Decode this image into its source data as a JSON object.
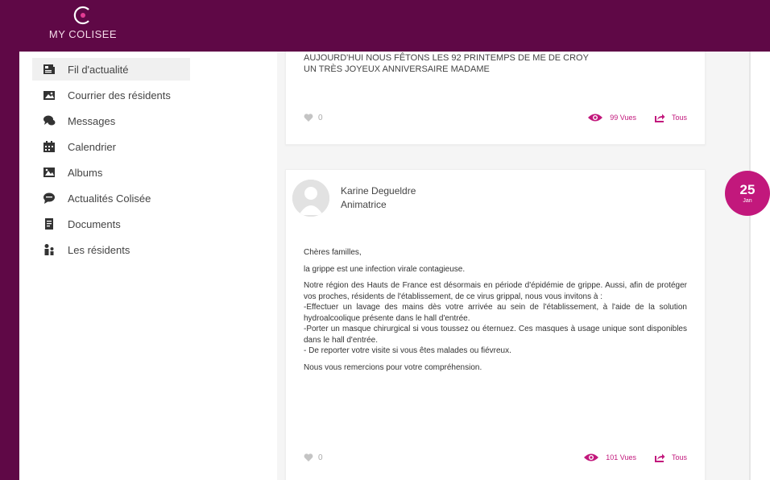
{
  "brand": {
    "name": "MY COLISEE"
  },
  "sidebar": {
    "items": [
      {
        "label": "Fil d'actualité",
        "icon": "newspaper-icon",
        "active": true
      },
      {
        "label": "Courrier des résidents",
        "icon": "mail-image-icon"
      },
      {
        "label": "Messages",
        "icon": "chat-bubbles-icon"
      },
      {
        "label": "Calendrier",
        "icon": "calendar-icon"
      },
      {
        "label": "Albums",
        "icon": "picture-icon"
      },
      {
        "label": "Actualités Colisée",
        "icon": "speech-bubble-icon"
      },
      {
        "label": "Documents",
        "icon": "document-icon"
      },
      {
        "label": "Les résidents",
        "icon": "people-icon"
      }
    ]
  },
  "posts": [
    {
      "lines": [
        "AUJOURD'HUI NOUS FÊTONS LES 92 PRINTEMPS DE ME DE CROY",
        "UN TRÈS JOYEUX ANNIVERSAIRE MADAME"
      ],
      "likes": "0",
      "views": "99 Vues",
      "share": "Tous"
    },
    {
      "author_name": "Karine Degueldre",
      "author_role": "Animatrice",
      "paragraphs": [
        "Chères familles,",
        "la grippe est une infection virale contagieuse.",
        "Notre région des Hauts de France est désormais en période d'épidémie de grippe. Aussi, afin de protéger vos proches, résidents de l'établissement, de ce virus grippal, nous vous invitons à :",
        "-Effectuer un lavage des mains dès votre arrivée au sein de l'établissement, à l'aide de la solution hydroalcoolique présente dans le hall d'entrée.",
        "-Porter un masque chirurgical si vous toussez ou éternuez. Ces masques à usage unique sont disponibles dans le hall d'entrée.",
        "- De reporter votre visite si vous êtes malades ou fiévreux.",
        "Nous vous remercions pour votre compréhension."
      ],
      "likes": "0",
      "views": "101 Vues",
      "share": "Tous"
    }
  ],
  "timeline": {
    "day": "25",
    "month": "Jan"
  },
  "colors": {
    "brand": "#5f0846",
    "accent": "#c2187c"
  }
}
